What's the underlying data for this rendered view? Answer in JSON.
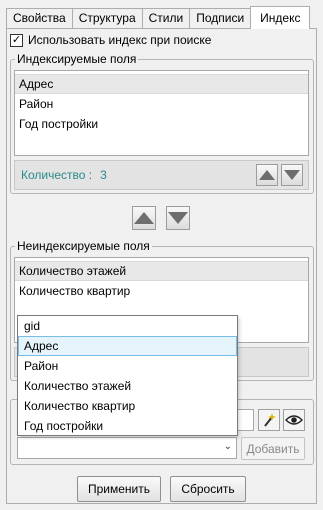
{
  "tabs": [
    {
      "label": "Свойства"
    },
    {
      "label": "Структура"
    },
    {
      "label": "Стили"
    },
    {
      "label": "Подписи"
    },
    {
      "label": "Индекс"
    }
  ],
  "use_index_checkbox": {
    "label": "Использовать индекс при поиске",
    "checked": true
  },
  "indexed": {
    "title": "Индексируемые поля",
    "items": [
      "Адрес",
      "Район",
      "Год постройки"
    ],
    "count_label": "Количество :",
    "count_value": "3"
  },
  "nonindexed": {
    "title": "Неиндексируемые поля",
    "items": [
      "Количество этажей",
      "Количество квартир"
    ]
  },
  "dropdown": {
    "items": [
      "gid",
      "Адрес",
      "Район",
      "Количество этажей",
      "Количество квартир",
      "Год постройки"
    ],
    "highlighted": 1
  },
  "add_button": {
    "label": "Добавить"
  },
  "footer": {
    "apply": "Применить",
    "reset": "Сбросить"
  },
  "colors": {
    "count_text": "#2a8a8a",
    "highlight": "#e5f3fb"
  }
}
